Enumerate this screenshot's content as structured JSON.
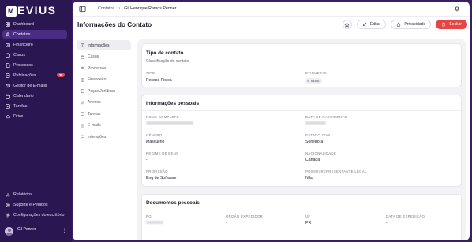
{
  "app": {
    "logo_text": "EVIUS",
    "logo_mark": "M"
  },
  "sidebar": {
    "items": [
      {
        "label": "Dashboard",
        "icon": "dashboard-icon"
      },
      {
        "label": "Contatos",
        "icon": "contacts-icon",
        "active": true
      },
      {
        "label": "Financeiro",
        "icon": "finance-icon"
      },
      {
        "label": "Casos",
        "icon": "cases-icon"
      },
      {
        "label": "Processos",
        "icon": "processes-icon"
      },
      {
        "label": "Publicações",
        "icon": "publications-icon",
        "badge": "35"
      },
      {
        "label": "Gestor de E-mails",
        "icon": "mail-icon"
      },
      {
        "label": "Calendário",
        "icon": "calendar-icon"
      },
      {
        "label": "Tarefas",
        "icon": "tasks-icon"
      },
      {
        "label": "Drive",
        "icon": "drive-icon"
      }
    ],
    "bottom_items": [
      {
        "label": "Relatórios",
        "icon": "reports-icon"
      },
      {
        "label": "Suporte e Pedidos",
        "icon": "support-icon"
      },
      {
        "label": "Configurações do escritório",
        "icon": "settings-icon"
      }
    ],
    "user": {
      "name": "Gil Penner",
      "menu": "⋮"
    }
  },
  "topbar": {
    "breadcrumb": [
      "Contatos",
      "Gil Henrique Ramos Penner"
    ]
  },
  "page": {
    "title": "Informações do Contato",
    "actions": {
      "edit": "Editar",
      "privacy": "Privacidade",
      "delete": "Excluir"
    }
  },
  "tabs": [
    {
      "label": "Informações",
      "active": true
    },
    {
      "label": "Casos"
    },
    {
      "label": "Processos"
    },
    {
      "label": "Financeiro"
    },
    {
      "label": "Peças Jurídicas"
    },
    {
      "label": "Anexos"
    },
    {
      "label": "Tarefas"
    },
    {
      "label": "E-mails"
    },
    {
      "label": "Interações"
    }
  ],
  "contact_type": {
    "title": "Tipo de contato",
    "subtitle": "Classificação do contato.",
    "type_label": "Tipo",
    "type_value": "Pessoa Física",
    "tags_label": "Etiquetas",
    "tag_value": "INSS"
  },
  "personal": {
    "title": "Informações pessoais",
    "fields": {
      "full_name_label": "Nome completo",
      "birth_label": "Data de nascimento",
      "gender_label": "Gênero",
      "gender_value": "Masculino",
      "civil_label": "Estado civil",
      "civil_value": "Solteiro(a)",
      "regime_label": "Regime de bens",
      "regime_value": "-",
      "nationality_label": "Nacionalidade",
      "nationality_value": "Canadá",
      "profession_label": "Profissão",
      "profession_value": "Eng de Software",
      "legal_rep_label": "Possui representante legal",
      "legal_rep_value": "Não"
    }
  },
  "documents": {
    "title": "Documentos pessoais",
    "fields": {
      "rg_label": "RG",
      "issuer_label": "Órgão expedidor",
      "issuer_value": "-",
      "uf_label": "UF",
      "uf_value": "PR",
      "issue_date_label": "Data de expedição",
      "issue_date_value": "-"
    }
  },
  "colors": {
    "sidebar": "#2a1650",
    "accent": "#4b2c84",
    "danger": "#e64545",
    "badge": "#e8424a"
  }
}
